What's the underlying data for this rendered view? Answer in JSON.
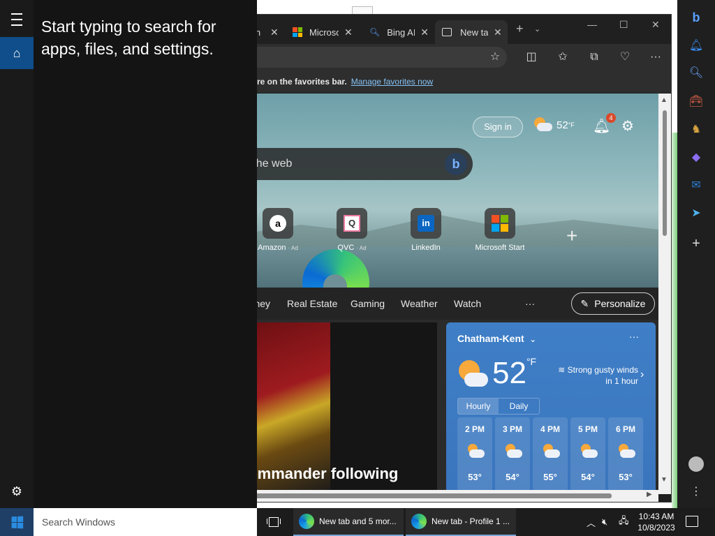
{
  "start_menu": {
    "hint": "Start typing to search for apps, files, and settings.",
    "search_placeholder": "Search Windows"
  },
  "browser": {
    "tabs": [
      {
        "label": "in"
      },
      {
        "label": "Microsoft"
      },
      {
        "label": "Bing AI"
      },
      {
        "label": "New tab"
      }
    ],
    "favbar": {
      "text": "re on the favorites bar.",
      "link": "Manage favorites now"
    },
    "ntp": {
      "signin": "Sign in",
      "weather_temp": "52",
      "weather_unit": "°F",
      "notif_count": "4",
      "search_placeholder": "ch the web",
      "tiles": [
        {
          "label": "Amazon",
          "ad": "· Ad"
        },
        {
          "label": "QVC",
          "ad": "· Ad"
        },
        {
          "label": "LinkedIn",
          "ad": ""
        },
        {
          "label": "Microsoft Start",
          "ad": ""
        }
      ],
      "categories": [
        "Money",
        "Real Estate",
        "Gaming",
        "Weather",
        "Watch"
      ],
      "more": "···",
      "personalize": "Personalize",
      "news_title": "commander following",
      "weather_card": {
        "location": "Chatham-Kent",
        "temp": "52",
        "unit": "°F",
        "alert_line1": "Strong gusty winds",
        "alert_line2": "in 1 hour",
        "tab_hourly": "Hourly",
        "tab_daily": "Daily",
        "hours": [
          {
            "time": "2 PM",
            "temp": "53°"
          },
          {
            "time": "3 PM",
            "temp": "54°"
          },
          {
            "time": "4 PM",
            "temp": "55°"
          },
          {
            "time": "5 PM",
            "temp": "54°"
          },
          {
            "time": "6 PM",
            "temp": "53°"
          }
        ]
      }
    }
  },
  "taskbar": {
    "app1": "New tab and 5 mor...",
    "app2": "New tab - Profile 1 ...",
    "time": "10:43 AM",
    "date": "10/8/2023"
  },
  "colors": {
    "start_selected": "#0f4e8a",
    "link": "#86c2f5",
    "weather_card": "#3f7fc7"
  }
}
